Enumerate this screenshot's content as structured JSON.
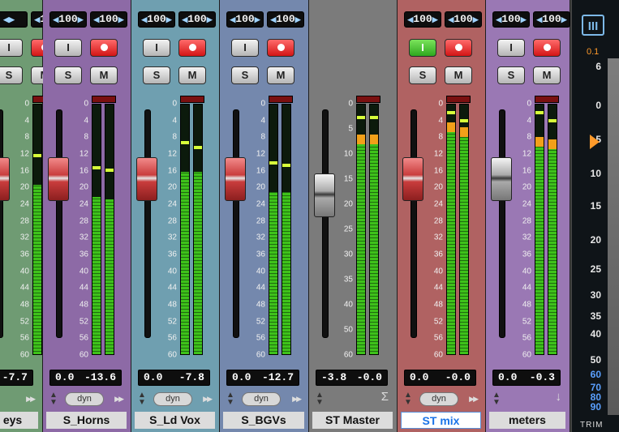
{
  "channels": [
    {
      "id": "keys",
      "name": "eys",
      "bg": "#6f9b73",
      "pan_left": "",
      "pan_right": "100",
      "input_active": false,
      "fader_style": "red",
      "fader_value": 0.28,
      "meter_l": 0.68,
      "meter_r": 0.69,
      "peak_l": 0.79,
      "peak_r": 0.81,
      "readout_left": "",
      "readout_right": "-7.7",
      "automation": "",
      "icon": "play-icon",
      "scale": [
        "0",
        "4",
        "8",
        "12",
        "16",
        "20",
        "24",
        "28",
        "32",
        "36",
        "40",
        "44",
        "48",
        "52",
        "56",
        "60"
      ],
      "selected": false
    },
    {
      "id": "horns",
      "name": "S_Horns",
      "bg": "#8d6aa6",
      "pan_left": "100",
      "pan_right": "100",
      "input_active": false,
      "fader_style": "red",
      "fader_value": 0.28,
      "meter_l": 0.63,
      "meter_r": 0.62,
      "peak_l": 0.74,
      "peak_r": 0.73,
      "readout_left": "0.0",
      "readout_right": "-13.6",
      "automation": "dyn",
      "icon": "play-icon",
      "scale": [
        "0",
        "4",
        "8",
        "12",
        "16",
        "20",
        "24",
        "28",
        "32",
        "36",
        "40",
        "44",
        "48",
        "52",
        "56",
        "60"
      ],
      "selected": false
    },
    {
      "id": "ldvox",
      "name": "S_Ld Vox",
      "bg": "#6f9fb0",
      "pan_left": "100",
      "pan_right": "100",
      "input_active": false,
      "fader_style": "red",
      "fader_value": 0.28,
      "meter_l": 0.73,
      "meter_r": 0.73,
      "peak_l": 0.84,
      "peak_r": 0.82,
      "readout_left": "0.0",
      "readout_right": "-7.8",
      "automation": "dyn",
      "icon": "play-icon",
      "scale": [
        "0",
        "4",
        "8",
        "12",
        "16",
        "20",
        "24",
        "28",
        "32",
        "36",
        "40",
        "44",
        "48",
        "52",
        "56",
        "60"
      ],
      "selected": false
    },
    {
      "id": "bgvs",
      "name": "S_BGVs",
      "bg": "#7488ad",
      "pan_left": "100",
      "pan_right": "100",
      "input_active": false,
      "fader_style": "red",
      "fader_value": 0.28,
      "meter_l": 0.65,
      "meter_r": 0.65,
      "peak_l": 0.76,
      "peak_r": 0.75,
      "readout_left": "0.0",
      "readout_right": "-12.7",
      "automation": "dyn",
      "icon": "play-icon",
      "scale": [
        "0",
        "4",
        "8",
        "12",
        "16",
        "20",
        "24",
        "28",
        "32",
        "36",
        "40",
        "44",
        "48",
        "52",
        "56",
        "60"
      ],
      "selected": false
    },
    {
      "id": "stmaster",
      "name": "ST Master",
      "bg": "#7b7b7b",
      "pan_left": "",
      "pan_right": "",
      "input_active": false,
      "fader_style": "gray",
      "fader_value": 0.35,
      "meter_l": 0.88,
      "meter_r": 0.88,
      "peak_l": 0.94,
      "peak_r": 0.94,
      "readout_left": "-3.8",
      "readout_right": "-0.0",
      "automation": "",
      "icon": "sigma-icon",
      "scale": [
        "0",
        "5",
        "10",
        "15",
        "20",
        "25",
        "30",
        "35",
        "40",
        "50",
        "60"
      ],
      "selected": false
    },
    {
      "id": "stmix",
      "name": "ST mix",
      "bg": "#b06262",
      "pan_left": "100",
      "pan_right": "100",
      "input_active": true,
      "fader_style": "red",
      "fader_value": 0.28,
      "meter_l": 0.93,
      "meter_r": 0.91,
      "peak_l": 0.96,
      "peak_r": 0.93,
      "readout_left": "0.0",
      "readout_right": "-0.0",
      "automation": "dyn",
      "icon": "play-icon",
      "scale": [
        "0",
        "4",
        "8",
        "12",
        "16",
        "20",
        "24",
        "28",
        "32",
        "36",
        "40",
        "44",
        "48",
        "52",
        "56",
        "60"
      ],
      "selected": true
    },
    {
      "id": "meters",
      "name": "meters",
      "bg": "#9a78b4",
      "pan_left": "100",
      "pan_right": "100",
      "input_active": false,
      "fader_style": "gray",
      "fader_value": 0.28,
      "meter_l": 0.87,
      "meter_r": 0.86,
      "peak_l": 0.96,
      "peak_r": 0.93,
      "readout_left": "0.0",
      "readout_right": "-0.3",
      "automation": "",
      "icon": "down-arrow-icon",
      "scale": [
        "0",
        "4",
        "8",
        "12",
        "16",
        "20",
        "24",
        "28",
        "32",
        "36",
        "40",
        "44",
        "48",
        "52",
        "56",
        "60"
      ],
      "selected": false
    }
  ],
  "buttons": {
    "input": "I",
    "solo": "S",
    "mute": "M"
  },
  "plugin": {
    "logo": "III",
    "peak_value": "0.1",
    "scale": [
      "6",
      "0",
      "5",
      "10",
      "15",
      "20",
      "25",
      "30",
      "35",
      "40",
      "50",
      "60",
      "70",
      "80",
      "90"
    ],
    "trim_label": "TRIM",
    "marker_color": "#ff9a2a"
  }
}
